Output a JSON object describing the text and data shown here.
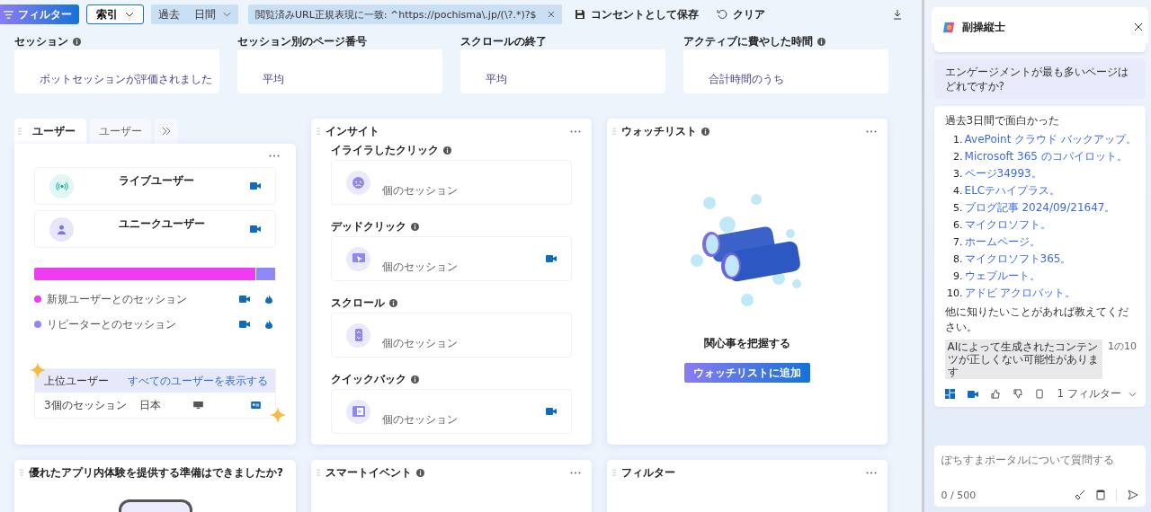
{
  "toolbar": {
    "filter_button": "フィルター",
    "index_dropdown": "索引",
    "date_chip": {
      "label": "過去",
      "unit": "日間"
    },
    "url_filter": "閲覧済みURL正規表現に一致: ^https://pochisma\\.jp/(\\?.*)?$",
    "save": "コンセントとして保存",
    "clear": "クリア"
  },
  "metrics": [
    {
      "label": "セッション",
      "info": true,
      "caption": "ボットセッションが評価されました"
    },
    {
      "label": "セッション別のページ番号",
      "info": false,
      "caption": "平均"
    },
    {
      "label": "スクロールの終了",
      "info": false,
      "caption": "平均"
    },
    {
      "label": "アクティブに費やした時間",
      "info": true,
      "caption": "合計時間のうち"
    }
  ],
  "users_widget": {
    "tabs": [
      {
        "label": "ユーザー",
        "selected": true
      },
      {
        "label": "ユーザー",
        "selected": false
      }
    ],
    "items": [
      {
        "kind": "live",
        "name": "ライブユーザー"
      },
      {
        "kind": "unique",
        "name": "ユニークユーザー"
      }
    ],
    "legend": [
      {
        "label": "新規ユーザーとのセッション",
        "color": "#ee3cf3",
        "level": 0.92
      },
      {
        "label": "リピーターとのセッション",
        "color": "#8f87f7",
        "level": 0.08
      }
    ],
    "top_users": {
      "title": "上位ユーザー",
      "link": "すべてのユーザーを表示する",
      "sessions": "3個のセッション",
      "country": "日本"
    }
  },
  "insights": {
    "title": "インサイト",
    "items": [
      {
        "kind": "rage",
        "label": "イライラしたクリック",
        "caption": "個のセッション",
        "recording": false
      },
      {
        "kind": "dead",
        "label": "デッドクリック",
        "caption": "個のセッション",
        "recording": true
      },
      {
        "kind": "scroll",
        "label": "スクロール",
        "caption": "個のセッション",
        "recording": false
      },
      {
        "kind": "quickback",
        "label": "クイックバック",
        "caption": "個のセッション",
        "recording": true
      }
    ]
  },
  "watchlist": {
    "title": "ウォッチリスト",
    "info": true,
    "caption": "関心事を把握する",
    "button": "ウォッチリストに追加"
  },
  "lower_widgets": [
    {
      "title": "優れたアプリ内体験を提供する準備はできましたか?",
      "info": false
    },
    {
      "title": "スマートイベント",
      "info": true
    },
    {
      "title": "フィルター",
      "info": false
    }
  ],
  "copilot": {
    "title": "副操縦士",
    "question": "エンゲージメントが最も多いページはどれですか?",
    "intro": "過去3日間で面白かった",
    "pages": [
      {
        "number": "1.",
        "text": "AvePoint クラウド バックアップ。"
      },
      {
        "number": "2.",
        "text": "Microsoft 365 のコパイロット。"
      },
      {
        "number": "3.",
        "text": "ページ34993。"
      },
      {
        "number": "4.",
        "text": "ELCテハイプラス。"
      },
      {
        "number": "5.",
        "text": "ブログ記事 2024/09/21647。"
      },
      {
        "number": "6.",
        "text": "マイクロソフト。"
      },
      {
        "number": "7.",
        "text": "ホームページ。"
      },
      {
        "number": "8.",
        "text": "マイクロソフト365。"
      },
      {
        "number": "9.",
        "text": "ウェブルート。"
      },
      {
        "number": "10.",
        "text": "アドビ アクロバット。"
      }
    ],
    "outro": "他に知りたいことがあれば教えてください。",
    "disclaimer": "AIによって生成されたコンテンツが正しくない可能性があります",
    "counter": "1の10",
    "filter": "1 フィルター",
    "input": {
      "placeholder": "ぽちすまポータルについて質問する",
      "count": "0 / 500"
    }
  }
}
